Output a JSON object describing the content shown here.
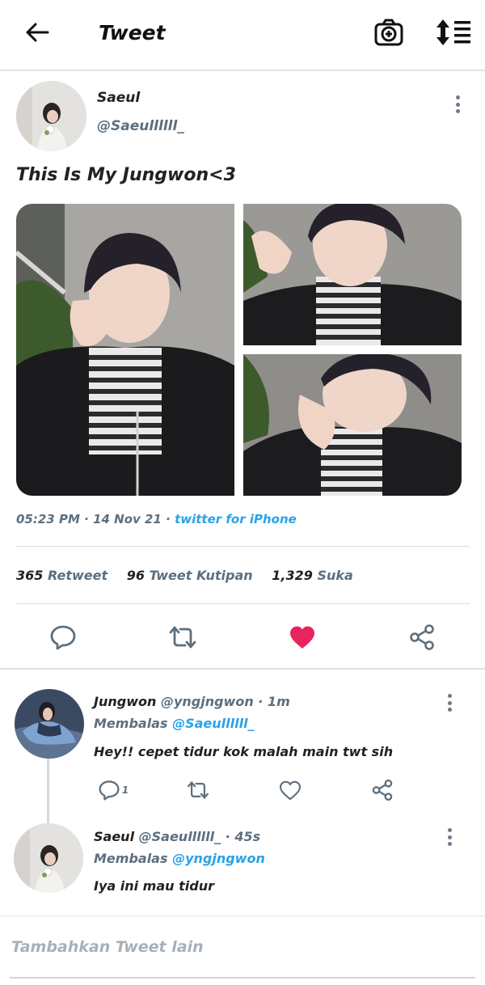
{
  "header": {
    "title": "Tweet",
    "back_icon": "arrow-left-icon",
    "camera_icon": "camera-plus-icon",
    "sort_icon": "sort-icon"
  },
  "tweet": {
    "name": "Saeul",
    "handle": "@Saeullllll_",
    "text": "This Is My Jungwon<3",
    "time": "05:23 PM",
    "sep1": "·",
    "date": "14 Nov 21",
    "sep2": "·",
    "source": "twitter for iPhone",
    "stats": {
      "retweets": "365",
      "retweets_label": "Retweet",
      "quotes": "96",
      "quotes_label": "Tweet Kutipan",
      "likes": "1,329",
      "likes_label": "Suka"
    }
  },
  "replies": [
    {
      "name": "Jungwon",
      "handle": "@yngjngwon",
      "time": "· 1m",
      "reply_prefix": "Membalas",
      "reply_to": "@Saeullllll_",
      "text": "Hey!! cepet tidur kok malah main twt sih",
      "reply_count": "1"
    },
    {
      "name": "Saeul",
      "handle": "@Saeullllll_",
      "time": "· 45s",
      "reply_prefix": "Membalas",
      "reply_to": "@yngjngwon",
      "text": "Iya ini mau tidur"
    }
  ],
  "compose": {
    "placeholder": "Tambahkan Tweet lain"
  },
  "colors": {
    "accent": "#2aa2e6",
    "secondary_text": "#5d6f7e",
    "like": "#e8245c",
    "icon": "#5d6f7e"
  }
}
